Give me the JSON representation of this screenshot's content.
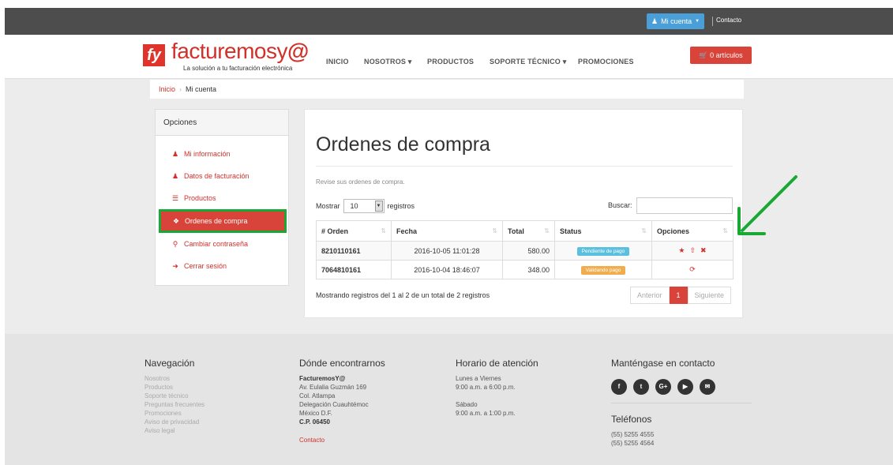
{
  "topbar": {
    "account_label": "Mi cuenta",
    "contact_label": "Contacto"
  },
  "header": {
    "logo_mark": "fy",
    "logo_text_main": "facturemosy",
    "logo_text_at": "@",
    "tagline": "La solución a tu facturación electrónica",
    "nav": [
      "INICIO",
      "NOSOTROS ▾",
      "PRODUCTOS",
      "SOPORTE TÉCNICO ▾",
      "PROMOCIONES"
    ],
    "cart_label": "0 artículos"
  },
  "breadcrumb": {
    "home": "Inicio",
    "separator": "›",
    "current": "Mi cuenta"
  },
  "sidebar": {
    "title": "Opciones",
    "items": [
      {
        "label": "Mi información",
        "icon": "user-icon"
      },
      {
        "label": "Datos de facturación",
        "icon": "user-icon"
      },
      {
        "label": "Productos",
        "icon": "list-icon"
      },
      {
        "label": "Ordenes de compra",
        "icon": "tag-icon"
      },
      {
        "label": "Cambiar contraseña",
        "icon": "key-icon"
      },
      {
        "label": "Cerrar sesión",
        "icon": "sign-out-icon"
      }
    ]
  },
  "main": {
    "title": "Ordenes de compra",
    "subtitle": "Revise sus ordenes de compra.",
    "show_label": "Mostrar",
    "page_size": "10",
    "records_label": "registros",
    "search_label": "Buscar:",
    "columns": [
      "# Orden",
      "Fecha",
      "Total",
      "Status",
      "Opciones"
    ],
    "rows": [
      {
        "order": "8210110161",
        "date": "2016-10-05 11:01:28",
        "total": "580.00",
        "status": "Pendiente de pago",
        "status_color": "#5bc0de"
      },
      {
        "order": "7064810161",
        "date": "2016-10-04 18:46:07",
        "total": "348.00",
        "status": "Validando pago",
        "status_color": "#f0ad4e"
      }
    ],
    "showing_text": "Mostrando registros del 1 al 2 de un total de 2 registros",
    "pager": {
      "prev": "Anterior",
      "current": "1",
      "next": "Siguiente"
    }
  },
  "footer": {
    "nav_title": "Navegación",
    "nav_links": [
      "Nosotros",
      "Productos",
      "Soporte técnico",
      "Preguntas frecuentes",
      "Promociones",
      "Aviso de privacidad",
      "Aviso legal"
    ],
    "where_title": "Dónde encontrarnos",
    "where_lines": [
      "FacturemosY@",
      "Av. Eulalia Guzmán 169",
      "Col. Atlampa",
      "Delegación Cuauhtémoc",
      "México D.F.",
      "C.P. 06450"
    ],
    "where_contact": "Contacto",
    "hours_title": "Horario de atención",
    "hours_lines": [
      "Lunes a Viernes",
      "9:00 a.m. a 6:00 p.m.",
      "",
      "Sábado",
      "9:00 a.m. a 1:00 p.m."
    ],
    "contact_title": "Manténgase en contacto",
    "social": [
      "facebook-icon",
      "twitter-icon",
      "google-plus-icon",
      "youtube-icon",
      "email-icon"
    ],
    "phones_title": "Teléfonos",
    "phones": [
      "(55) 5255 4555",
      "(55) 5255 4564"
    ]
  },
  "colors": {
    "brand_red": "#d9443a",
    "highlight_green": "#1aa834",
    "info": "#5bc0de",
    "warning": "#f0ad4e"
  }
}
